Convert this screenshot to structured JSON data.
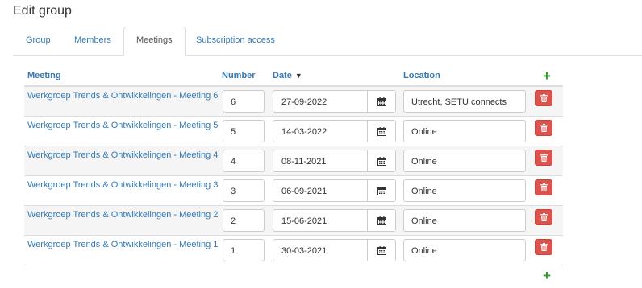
{
  "page": {
    "title": "Edit group"
  },
  "tabs": [
    {
      "label": "Group",
      "active": false
    },
    {
      "label": "Members",
      "active": false
    },
    {
      "label": "Meetings",
      "active": true
    },
    {
      "label": "Subscription access",
      "active": false
    }
  ],
  "table": {
    "headers": {
      "meeting": "Meeting",
      "number": "Number",
      "date": "Date",
      "location": "Location"
    },
    "sort_icon": "triangle-down-icon",
    "add_icon": "plus-icon",
    "rows": [
      {
        "meeting": "Werkgroep Trends & Ontwikkelingen - Meeting 6",
        "number": "6",
        "date": "27-09-2022",
        "location": "Utrecht, SETU connects"
      },
      {
        "meeting": "Werkgroep Trends & Ontwikkelingen - Meeting 5",
        "number": "5",
        "date": "14-03-2022",
        "location": "Online"
      },
      {
        "meeting": "Werkgroep Trends & Ontwikkelingen - Meeting 4",
        "number": "4",
        "date": "08-11-2021",
        "location": "Online"
      },
      {
        "meeting": "Werkgroep Trends & Ontwikkelingen - Meeting 3",
        "number": "3",
        "date": "06-09-2021",
        "location": "Online"
      },
      {
        "meeting": "Werkgroep Trends & Ontwikkelingen - Meeting 2",
        "number": "2",
        "date": "15-06-2021",
        "location": "Online"
      },
      {
        "meeting": "Werkgroep Trends & Ontwikkelingen - Meeting 1",
        "number": "1",
        "date": "30-03-2021",
        "location": "Online"
      }
    ]
  },
  "colors": {
    "link": "#337ab7",
    "danger": "#d9534f",
    "add": "#2c9c2c"
  }
}
